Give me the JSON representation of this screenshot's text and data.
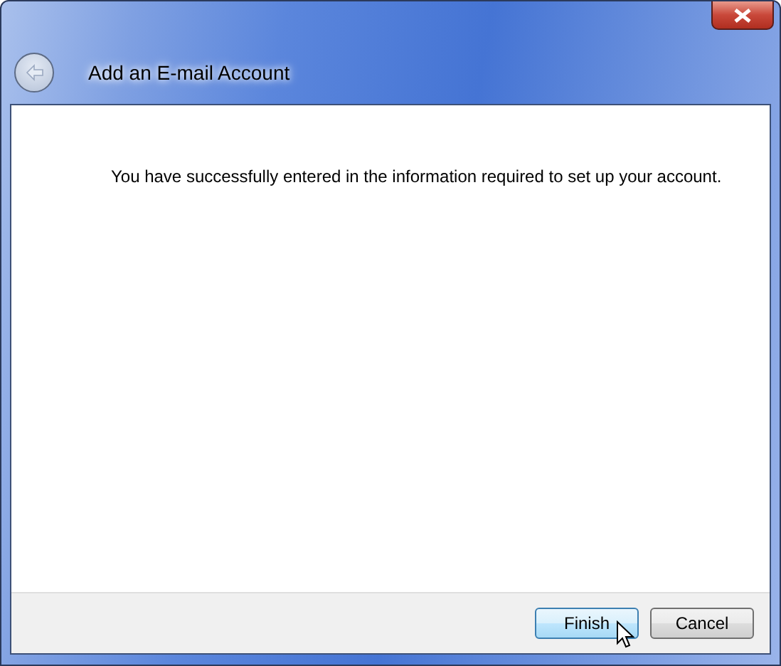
{
  "window": {
    "title": "Add an E-mail Account"
  },
  "message": "You have successfully entered in the information required to set up your account.",
  "buttons": [
    {
      "label": "Finish",
      "hovered": true
    },
    {
      "label": "Cancel",
      "hovered": false
    }
  ]
}
